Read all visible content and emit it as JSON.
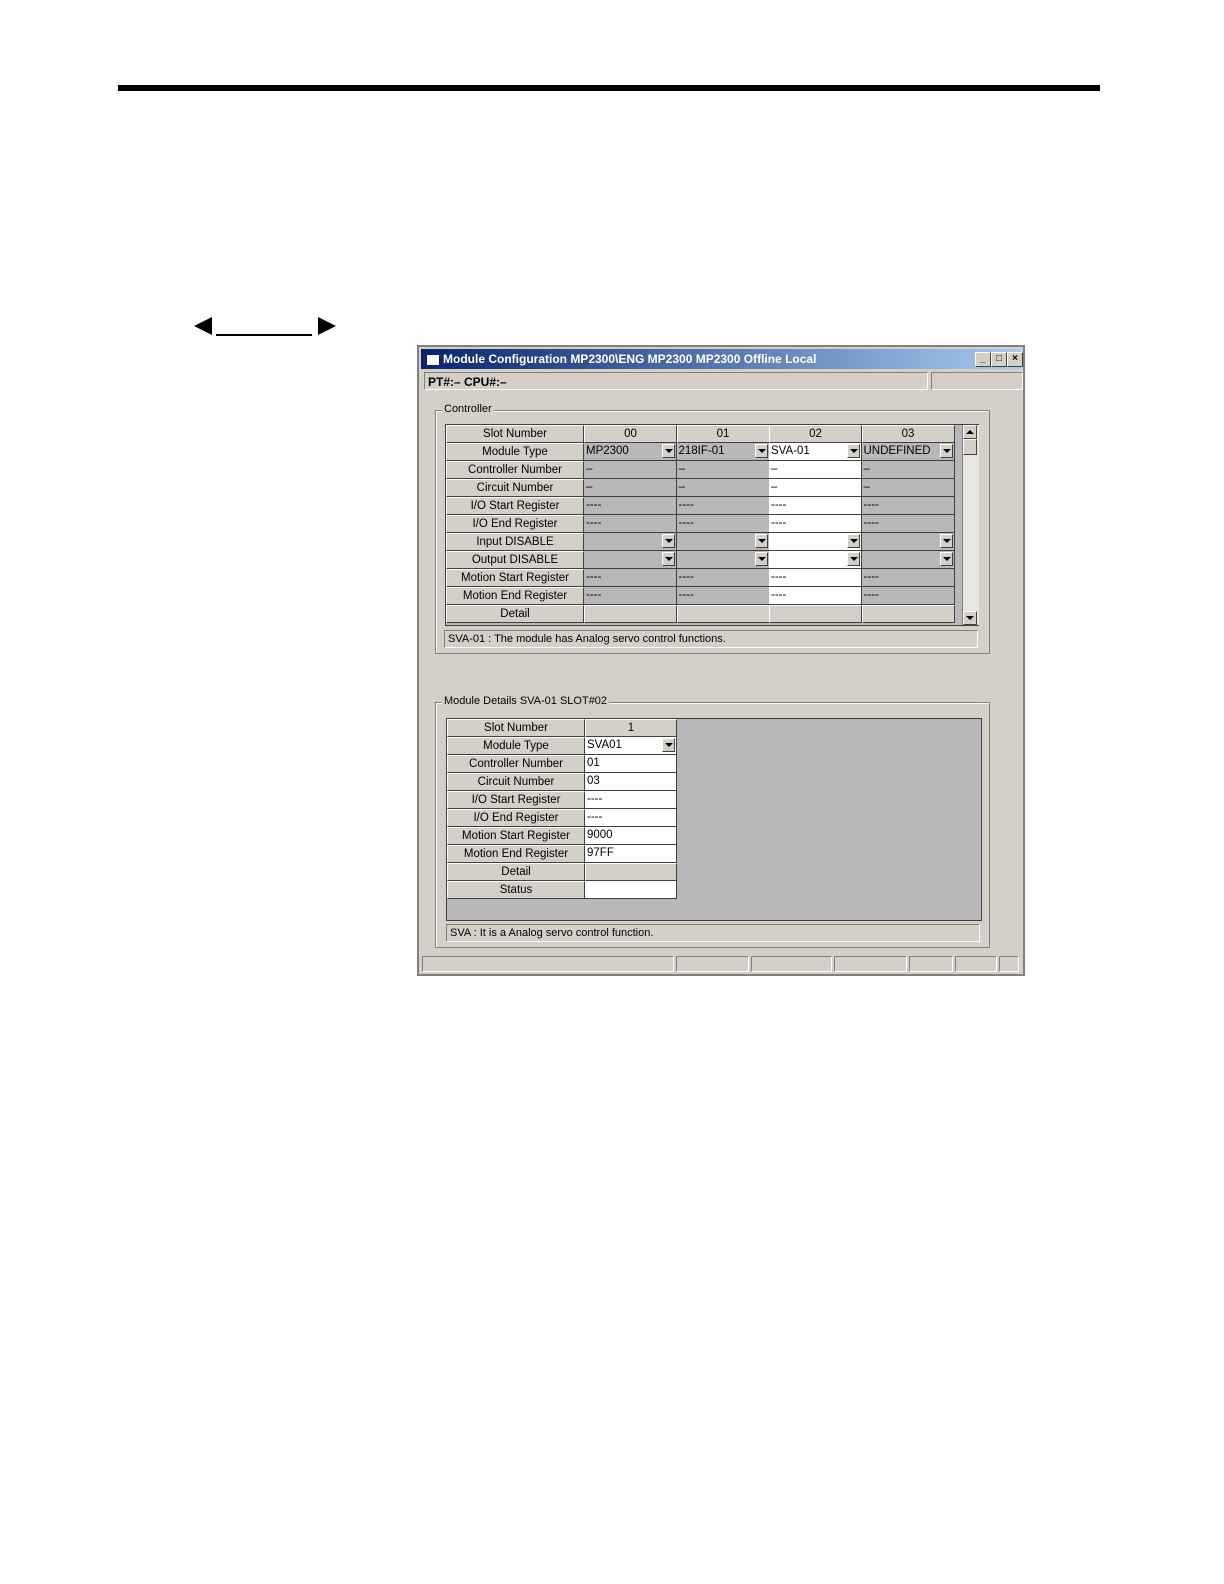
{
  "window": {
    "title": "Module Configuration   MP2300\\ENG  MP2300  MP2300    Offline  Local",
    "info": "PT#:– CPU#:–"
  },
  "controller": {
    "group_label": "Controller",
    "row_headers": [
      "Slot Number",
      "Module Type",
      "Controller Number",
      "Circuit Number",
      "I/O Start Register",
      "I/O End Register",
      "Input DISABLE",
      "Output DISABLE",
      "Motion Start Register",
      "Motion End Register",
      "Detail"
    ],
    "slots": [
      {
        "slot": "00",
        "module_type": "MP2300",
        "controller_number": "–",
        "circuit_number": "–",
        "io_start": "----",
        "io_end": "----",
        "motion_start": "----",
        "motion_end": "----"
      },
      {
        "slot": "01",
        "module_type": "218IF-01",
        "controller_number": "–",
        "circuit_number": "–",
        "io_start": "----",
        "io_end": "----",
        "motion_start": "----",
        "motion_end": "----"
      },
      {
        "slot": "02",
        "module_type": "SVA-01",
        "controller_number": "–",
        "circuit_number": "–",
        "io_start": "----",
        "io_end": "----",
        "motion_start": "----",
        "motion_end": "----"
      },
      {
        "slot": "03",
        "module_type": "UNDEFINED",
        "controller_number": "–",
        "circuit_number": "–",
        "io_start": "----",
        "io_end": "----",
        "motion_start": "----",
        "motion_end": "----"
      }
    ],
    "message": "SVA-01 : The module has Analog servo control functions."
  },
  "details": {
    "group_label": "Module Details  SVA-01  SLOT#02",
    "row_headers": [
      "Slot Number",
      "Module Type",
      "Controller Number",
      "Circuit Number",
      "I/O Start Register",
      "I/O End Register",
      "Motion Start Register",
      "Motion End Register",
      "Detail",
      "Status"
    ],
    "slot": "1",
    "module_type": "SVA01",
    "controller_number": "01",
    "circuit_number": "03",
    "io_start": "----",
    "io_end": "----",
    "motion_start": "9000",
    "motion_end": "97FF",
    "message": "SVA : It is a Analog servo control function."
  }
}
